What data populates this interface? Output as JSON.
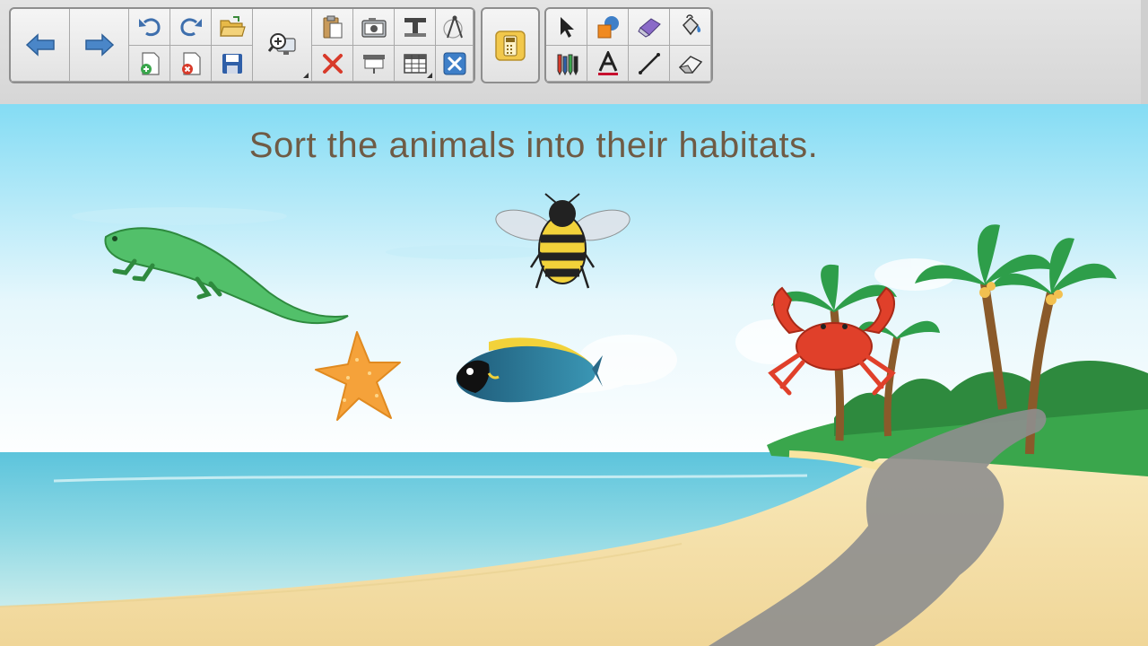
{
  "toolbar": {
    "nav": [
      {
        "name": "back-arrow-icon",
        "label": "Back"
      },
      {
        "name": "forward-arrow-icon",
        "label": "Forward"
      }
    ],
    "tools": [
      "undo-icon",
      "redo-icon",
      "open-folder-icon",
      "new-page-icon",
      "delete-page-icon",
      "save-icon",
      "zoom-icon",
      "paste-icon",
      "camera-icon",
      "text-tool-icon",
      "compass-icon",
      "delete-icon",
      "screen-shade-icon",
      "table-icon",
      "tools-icon",
      "calculator-icon",
      "select-arrow-icon",
      "shapes-icon",
      "magic-pen-icon",
      "fill-bucket-icon",
      "pens-icon",
      "text-icon",
      "line-icon",
      "eraser-icon"
    ],
    "colors": {
      "arrow": "#4a86c8",
      "delete": "#d83a2a",
      "highlight": "#f2c84b"
    }
  },
  "canvas": {
    "prompt": "Sort the animals into their habitats.",
    "animals": [
      "lizard",
      "bee",
      "starfish",
      "fish",
      "crab"
    ],
    "colors": {
      "sky": "#84dcf4",
      "sea": "#5cc4dc",
      "sand": "#f4dea4",
      "grass": "#3aa64c",
      "text": "#6f5b45"
    }
  }
}
